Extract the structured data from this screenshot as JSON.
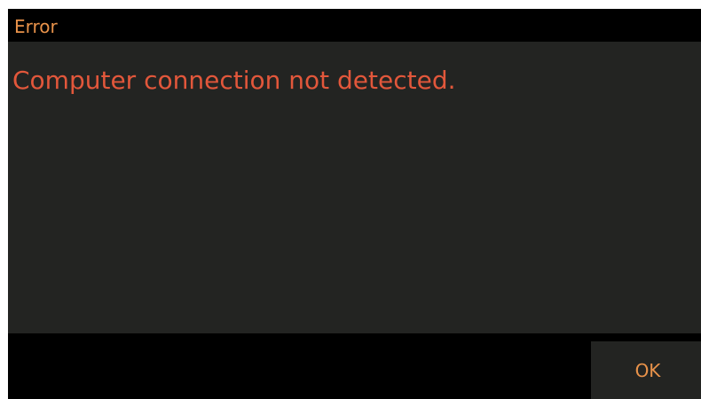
{
  "dialog": {
    "title": "Error",
    "message": "Computer connection not detected.",
    "ok_label": "OK"
  },
  "colors": {
    "title_text": "#e8924a",
    "message_text": "#e2573b",
    "panel_background": "#232422",
    "frame_background": "#000000"
  }
}
